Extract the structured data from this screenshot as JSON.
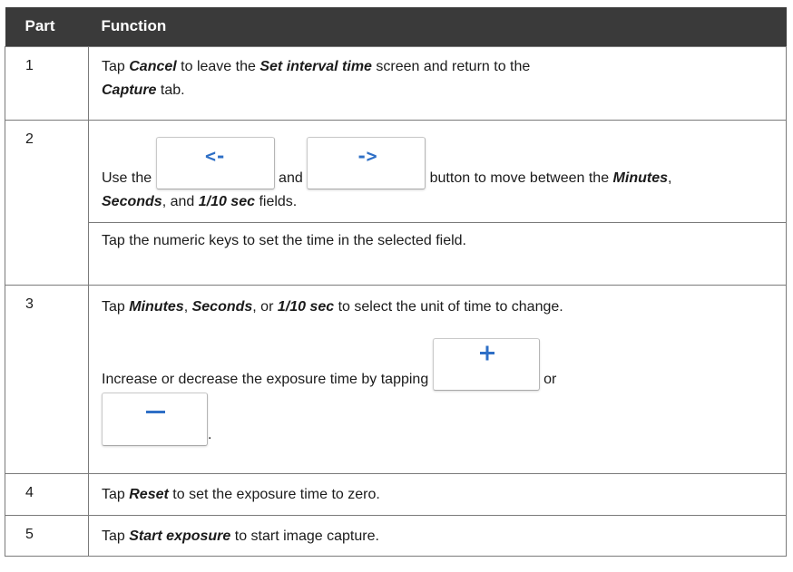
{
  "header": {
    "part": "Part",
    "function": "Function"
  },
  "rows": [
    {
      "part": "1",
      "l1a": "Tap ",
      "l1b": "Cancel",
      "l1c": " to leave the ",
      "l1d": "Set interval time",
      "l1e": " screen and return to the",
      "l2a": "Capture",
      "l2b": " tab."
    },
    {
      "part": "2",
      "use_the": "Use the ",
      "and": " and ",
      "button_text": " button to move between the ",
      "minutes": "Minutes",
      "comma": ",",
      "seconds": "Seconds",
      "comma_and": ", and ",
      "tenth": "1/10 sec",
      "fields": " fields.",
      "tap_numeric": "Tap the numeric keys to set the time in the selected field.",
      "left_btn": "<-",
      "right_btn": "->"
    },
    {
      "part": "3",
      "tap": "Tap ",
      "minutes": "Minutes",
      "comma1": ", ",
      "seconds": "Seconds",
      "comma_or": ", or ",
      "tenth": "1/10 sec",
      "select_text": " to select the unit of time to change.",
      "increase_text": "Increase or decrease the exposure time by tapping ",
      "or": " or",
      "period": ".",
      "plus_icon": "plus-icon",
      "minus_icon": "minus-icon"
    },
    {
      "part": "4",
      "a": "Tap ",
      "b": "Reset",
      "c": " to set the exposure time to zero."
    },
    {
      "part": "5",
      "a": "Tap ",
      "b": "Start exposure",
      "c": " to start image capture."
    }
  ],
  "colors": {
    "header_bg": "#3a3a3a",
    "border": "#7a7a7a",
    "icon_blue": "#2e6fc6"
  }
}
